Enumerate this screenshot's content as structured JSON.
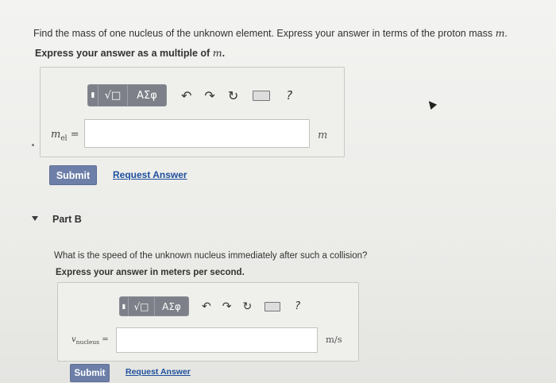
{
  "partA": {
    "question": "Find the mass of one nucleus of the unknown element. Express your answer in terms of the proton mass",
    "question_var": "m",
    "instruction": "Express your answer as a multiple of",
    "instruction_var": "m",
    "toolbar": {
      "template_label": "√□",
      "greek_label": "ΑΣφ",
      "undo_symbol": "↶",
      "redo_symbol": "↷",
      "reset_symbol": "↻",
      "help_label": "?"
    },
    "answer_label": "m",
    "answer_label_sub": "el",
    "answer_eq": "=",
    "input_value": "",
    "unit": "m",
    "submit_label": "Submit",
    "request_label": "Request Answer"
  },
  "partB": {
    "title": "Part B",
    "question": "What is the speed of the unknown nucleus immediately after such a collision?",
    "instruction": "Express your answer in meters per second.",
    "toolbar": {
      "template_label": "√□",
      "greek_label": "ΑΣφ",
      "undo_symbol": "↶",
      "redo_symbol": "↷",
      "reset_symbol": "↻",
      "help_label": "?"
    },
    "answer_label": "v",
    "answer_label_sub": "nucleus",
    "answer_eq": "=",
    "input_value": "",
    "unit": "m/s",
    "submit_label": "Submit",
    "request_label": "Request Answer"
  }
}
